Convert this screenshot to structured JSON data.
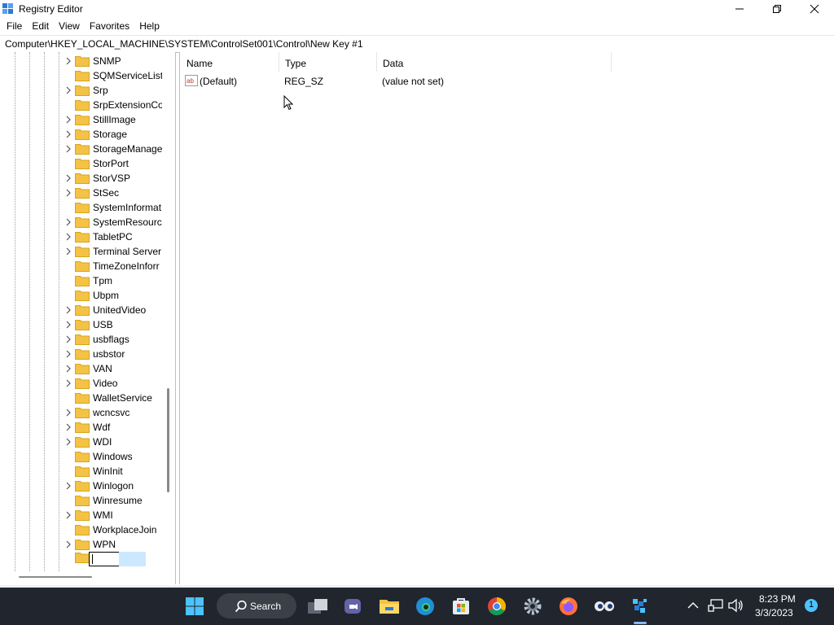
{
  "window": {
    "title": "Registry Editor"
  },
  "menu": [
    "File",
    "Edit",
    "View",
    "Favorites",
    "Help"
  ],
  "address": "Computer\\HKEY_LOCAL_MACHINE\\SYSTEM\\ControlSet001\\Control\\New Key #1",
  "tree": {
    "items": [
      {
        "label": "SNMP",
        "expandable": true
      },
      {
        "label": "SQMServiceList",
        "expandable": false
      },
      {
        "label": "Srp",
        "expandable": true
      },
      {
        "label": "SrpExtensionCo",
        "expandable": false
      },
      {
        "label": "StillImage",
        "expandable": true
      },
      {
        "label": "Storage",
        "expandable": true
      },
      {
        "label": "StorageManage",
        "expandable": true
      },
      {
        "label": "StorPort",
        "expandable": false
      },
      {
        "label": "StorVSP",
        "expandable": true
      },
      {
        "label": "StSec",
        "expandable": true
      },
      {
        "label": "SystemInformat",
        "expandable": false
      },
      {
        "label": "SystemResource",
        "expandable": true
      },
      {
        "label": "TabletPC",
        "expandable": true
      },
      {
        "label": "Terminal Server",
        "expandable": true
      },
      {
        "label": "TimeZoneInforr",
        "expandable": false
      },
      {
        "label": "Tpm",
        "expandable": false
      },
      {
        "label": "Ubpm",
        "expandable": false
      },
      {
        "label": "UnitedVideo",
        "expandable": true
      },
      {
        "label": "USB",
        "expandable": true
      },
      {
        "label": "usbflags",
        "expandable": true
      },
      {
        "label": "usbstor",
        "expandable": true
      },
      {
        "label": "VAN",
        "expandable": true
      },
      {
        "label": "Video",
        "expandable": true
      },
      {
        "label": "WalletService",
        "expandable": false
      },
      {
        "label": "wcncsvc",
        "expandable": true
      },
      {
        "label": "Wdf",
        "expandable": true
      },
      {
        "label": "WDI",
        "expandable": true
      },
      {
        "label": "Windows",
        "expandable": false
      },
      {
        "label": "WinInit",
        "expandable": false
      },
      {
        "label": "Winlogon",
        "expandable": true
      },
      {
        "label": "Winresume",
        "expandable": false
      },
      {
        "label": "WMI",
        "expandable": true
      },
      {
        "label": "WorkplaceJoin",
        "expandable": false
      },
      {
        "label": "WPN",
        "expandable": true
      }
    ],
    "rename_value": ""
  },
  "list": {
    "columns": [
      "Name",
      "Type",
      "Data"
    ],
    "rows": [
      {
        "name": "(Default)",
        "type": "REG_SZ",
        "data": "(value not set)"
      }
    ]
  },
  "taskbar": {
    "search_label": "Search",
    "apps": [
      "windows-start",
      "task-view",
      "teams",
      "file-explorer",
      "edge",
      "store",
      "chrome",
      "settings",
      "firefox",
      "ai-app",
      "regedit"
    ]
  },
  "tray": {
    "time": "8:23 PM",
    "date": "3/3/2023",
    "notification_count": "1"
  },
  "colors": {
    "folder": "#f4c244",
    "taskbar": "#20252e",
    "selection": "#cce8ff"
  }
}
